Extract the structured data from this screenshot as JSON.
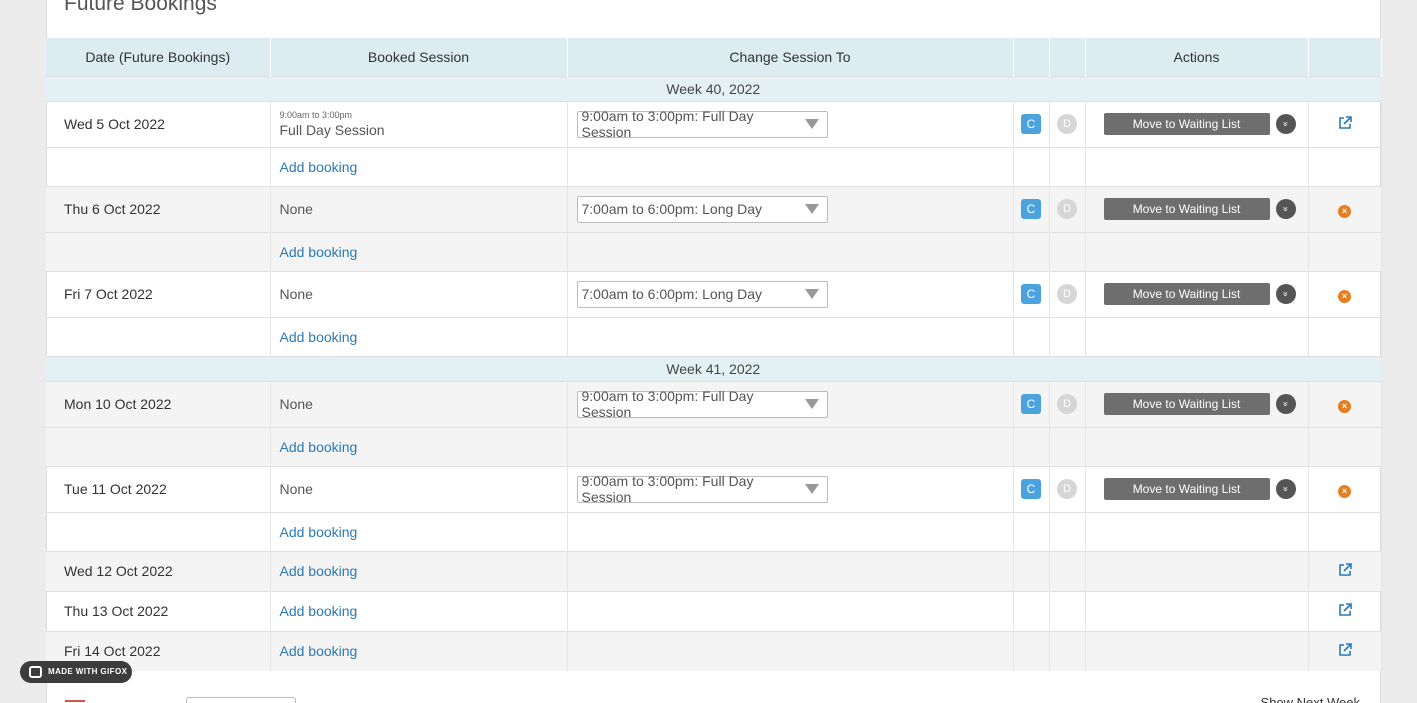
{
  "section_title": "Future Bookings",
  "headers": {
    "date": "Date (Future Bookings)",
    "booked_session": "Booked Session",
    "change_session": "Change Session To",
    "actions": "Actions"
  },
  "labels": {
    "add_booking": "Add booking",
    "move_to_waiting_list": "Move to Waiting List",
    "badge_c": "C",
    "badge_d": "D"
  },
  "weeks": [
    {
      "title": "Week 40, 2022",
      "days": [
        {
          "date": "Wed 5 Oct 2022",
          "booked_time": "9:00am to 3:00pm",
          "booked": "Full Day Session",
          "change_to": "9:00am to 3:00pm: Full Day Session",
          "action_icon": "external-link-icon"
        },
        {
          "date": "Thu 6 Oct 2022",
          "booked_time": "",
          "booked": "None",
          "change_to": "7:00am to 6:00pm: Long Day",
          "action_icon": "remove-icon"
        },
        {
          "date": "Fri 7 Oct 2022",
          "booked_time": "",
          "booked": "None",
          "change_to": "7:00am to 6:00pm: Long Day",
          "action_icon": "remove-icon"
        }
      ]
    },
    {
      "title": "Week 41, 2022",
      "days": [
        {
          "date": "Mon 10 Oct 2022",
          "booked_time": "",
          "booked": "None",
          "change_to": "9:00am to 3:00pm: Full Day Session",
          "action_icon": "remove-icon"
        },
        {
          "date": "Tue 11 Oct 2022",
          "booked_time": "",
          "booked": "None",
          "change_to": "9:00am to 3:00pm: Full Day Session",
          "action_icon": "remove-icon"
        }
      ]
    }
  ],
  "unbooked_days": [
    {
      "date": "Wed 12 Oct 2022"
    },
    {
      "date": "Thu 13 Oct 2022"
    },
    {
      "date": "Fri 14 Oct 2022"
    }
  ],
  "watermark": "MADE WITH GIFOX",
  "bottom_partial": "Show Next Week",
  "colors": {
    "link": "#2a7ab8",
    "header_bg": "#dcecf0",
    "badge_c": "#4aa3df",
    "remove": "#e67e22"
  }
}
